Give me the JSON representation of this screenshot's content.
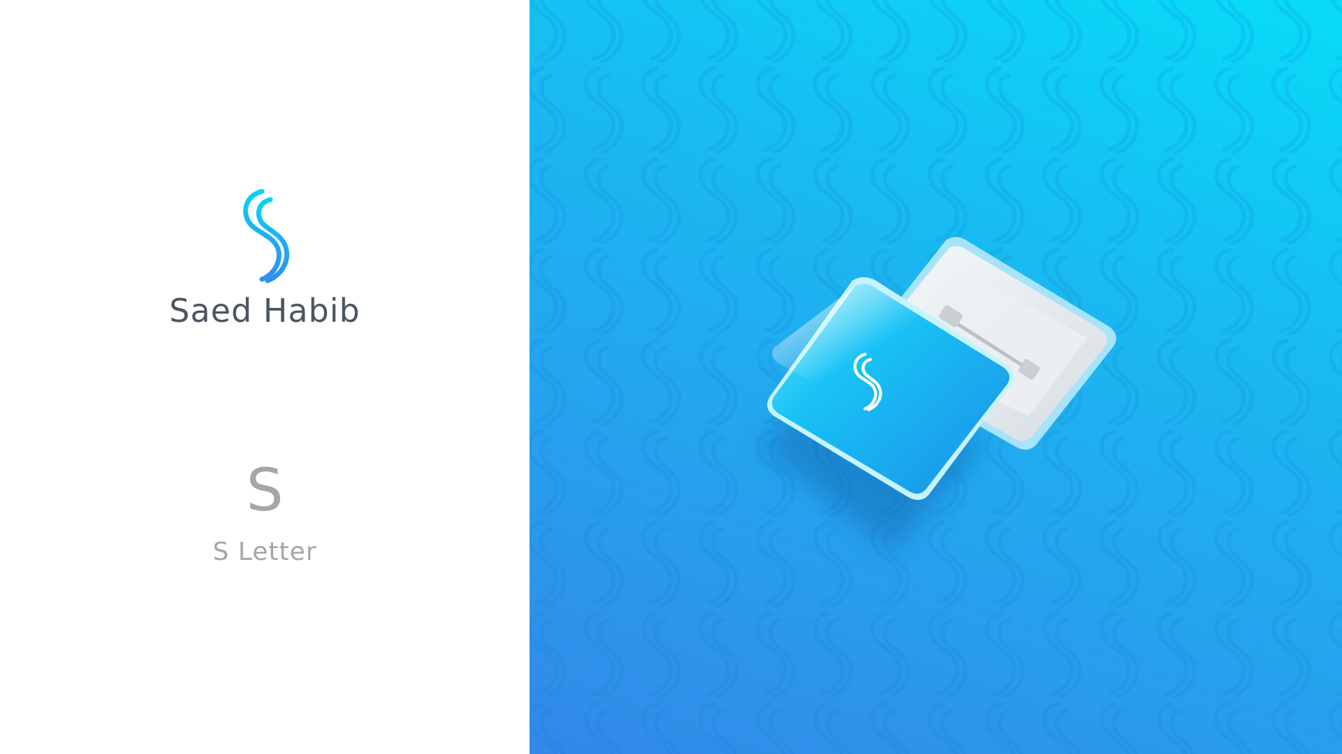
{
  "brand": {
    "name": "Saed Habib",
    "letter": "S",
    "letter_caption": "S Letter"
  },
  "colors": {
    "gradient_light": "#07dcf8",
    "gradient_mid": "#1bb6f1",
    "gradient_dark": "#3388e8",
    "text_dark": "#4a5563",
    "text_gray": "#a6a6a6"
  },
  "icons": {
    "primary_mark": "s-monogram-icon",
    "badge_mark": "s-monogram-icon",
    "pattern_mark": "s-monogram-icon"
  }
}
